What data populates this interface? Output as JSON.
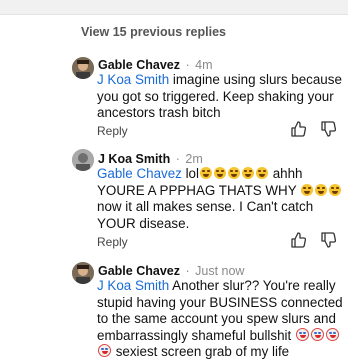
{
  "thread": {
    "view_previous_label": "View 15 previous replies"
  },
  "comments": [
    {
      "author": "Gable Chavez",
      "separator": "·",
      "time": "4m",
      "mention": "J Koa Smith",
      "text": " imagine using slurs because you got so triggered. Keep shaking your ancestors trash bitch",
      "reply_label": "Reply"
    },
    {
      "author": "J Koa Smith",
      "separator": "·",
      "time": "2m",
      "mention": "Gable Chavez",
      "text_a": " lol",
      "text_b": " ahhh YOURE A PPPHAG THATS WHY ",
      "text_c": " now it all makes sense. I Can't catch YOUR disease.",
      "reply_label": "Reply"
    },
    {
      "author": "Gable Chavez",
      "separator": "·",
      "time": "Just now",
      "mention": "J Koa Smith",
      "text": " Another slur?? You're really stupid having your BUSINESS connected to the same account you spew slurs and embarrassingly shameful bullshit ",
      "text_tail": " sexiest screen grab of my life"
    }
  ],
  "icons": {
    "like": "thumbs-up-icon",
    "dislike": "thumbs-down-icon",
    "laugh": "face-with-tears-of-joy-emoji",
    "clown": "clown-face-emoji"
  }
}
